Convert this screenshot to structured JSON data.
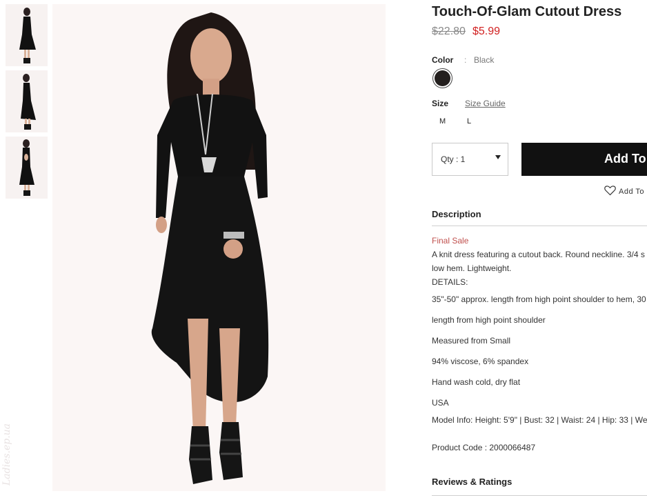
{
  "product": {
    "title": "Touch-Of-Glam Cutout Dress",
    "price_original": "$22.80",
    "price_sale": "$5.99"
  },
  "color": {
    "label": "Color",
    "separator": ":",
    "selected": "Black",
    "swatch_hex": "#231f1e"
  },
  "size": {
    "label": "Size",
    "guide_link": "Size Guide",
    "options": [
      "M",
      "L"
    ]
  },
  "quantity": {
    "label": "Qty : 1"
  },
  "actions": {
    "add_to_bag": "Add To",
    "wishlist": "Add To"
  },
  "description": {
    "heading": "Description",
    "final_sale": "Final Sale",
    "text_line1": "A knit dress featuring a cutout back. Round neckline. 3/4 s",
    "text_line2": "low hem. Lightweight.",
    "details_label": "DETAILS:",
    "details": [
      "35\"-50\" approx. length from high point shoulder to hem, 30",
      "length from high point shoulder",
      "Measured from Small",
      "94% viscose, 6% spandex",
      "Hand wash cold, dry flat",
      "USA"
    ],
    "model_info": "Model Info: Height: 5'9\" | Bust: 32 | Waist: 24 | Hip: 33 | We",
    "product_code": "Product Code : 2000066487"
  },
  "reviews": {
    "heading": "Reviews & Ratings"
  },
  "watermark": "Ladies.ep.ua"
}
